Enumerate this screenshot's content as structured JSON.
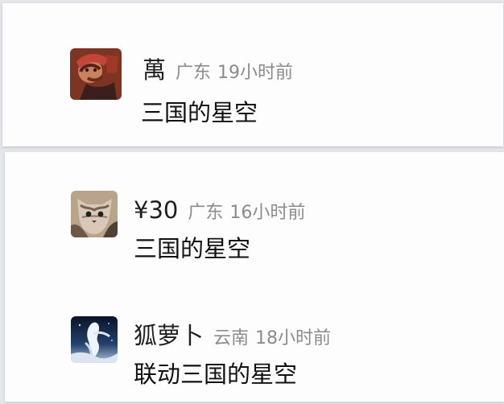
{
  "comments": [
    {
      "username": "萬",
      "region": "广东",
      "time": "19小时前",
      "content": "三国的星空",
      "avatar_icon": "man-portrait-avatar"
    },
    {
      "username": "¥30",
      "region": "广东",
      "time": "16小时前",
      "content": "三国的星空",
      "avatar_icon": "cat-avatar"
    },
    {
      "username": "狐萝卜",
      "region": "云南",
      "time": "18小时前",
      "content": "联动三国的星空",
      "avatar_icon": "white-statue-avatar"
    }
  ],
  "colors": {
    "background": "#e4e6ea",
    "card": "#fdfdfd",
    "username": "#1f1f1f",
    "meta": "#8b8b8b",
    "content": "#111111"
  }
}
